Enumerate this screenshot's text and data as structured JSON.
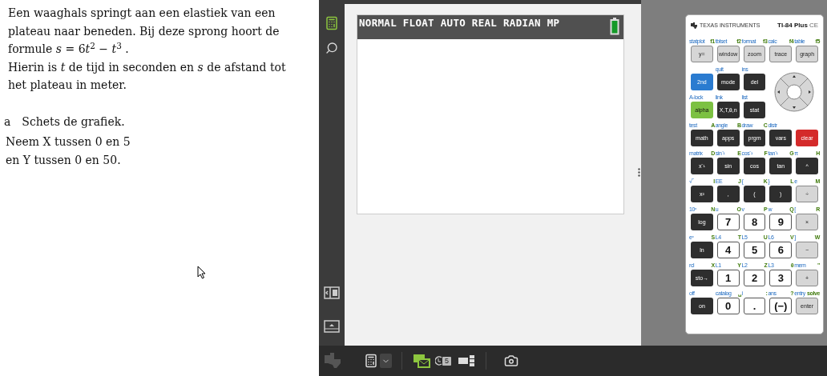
{
  "problem": {
    "lines": [
      "Een waaghals springt aan een elastiek van een",
      "plateau naar beneden. Bij deze sprong hoort de",
      "formule *s* = 6𝑡$^{2}$ − *t*$^{3}$ .",
      "Hierin is *t* de tijd in seconden en *s* de afstand tot",
      "het plateau in meter."
    ],
    "question": {
      "letter": "a",
      "text": "Schets de grafiek."
    },
    "hint": [
      "Neem X tussen 0 en 5",
      "en Y tussen 0 en 50."
    ]
  },
  "screen": {
    "status": "NORMAL FLOAT AUTO REAL RADIAN MP"
  },
  "calculator": {
    "brand": "TEXAS INSTRUMENTS",
    "model": "TI-84 Plus",
    "edition": "CE",
    "rows": [
      [
        {
          "label": "y=",
          "kind": "gray",
          "second": "statplot",
          "alpha": "f1"
        },
        {
          "label": "window",
          "kind": "gray",
          "second": "tblset",
          "alpha": "f2"
        },
        {
          "label": "zoom",
          "kind": "gray",
          "second": "format",
          "alpha": "f3"
        },
        {
          "label": "trace",
          "kind": "gray",
          "second": "calc",
          "alpha": "f4"
        },
        {
          "label": "graph",
          "kind": "gray",
          "second": "table",
          "alpha": "f5"
        }
      ],
      [
        {
          "label": "2nd",
          "kind": "blue"
        },
        {
          "label": "mode",
          "kind": "dark",
          "second": "quit"
        },
        {
          "label": "del",
          "kind": "dark",
          "second": "ins"
        }
      ],
      [
        {
          "label": "alpha",
          "kind": "green",
          "second": "A-lock"
        },
        {
          "label": "X,T,θ,n",
          "kind": "dark",
          "second": "link"
        },
        {
          "label": "stat",
          "kind": "dark",
          "second": "list"
        }
      ],
      [
        {
          "label": "math",
          "kind": "dark",
          "second": "test",
          "alpha": "A"
        },
        {
          "label": "apps",
          "kind": "dark",
          "second": "angle",
          "alpha": "B"
        },
        {
          "label": "prgm",
          "kind": "dark",
          "second": "draw",
          "alpha": "C"
        },
        {
          "label": "vars",
          "kind": "dark",
          "second": "distr"
        },
        {
          "label": "clear",
          "kind": "red"
        }
      ],
      [
        {
          "label": "x⁻¹",
          "kind": "dark",
          "second": "matrix",
          "alpha": "D"
        },
        {
          "label": "sin",
          "kind": "dark",
          "second": "sin⁻¹",
          "alpha": "E"
        },
        {
          "label": "cos",
          "kind": "dark",
          "second": "cos⁻¹",
          "alpha": "F"
        },
        {
          "label": "tan",
          "kind": "dark",
          "second": "tan⁻¹",
          "alpha": "G"
        },
        {
          "label": "^",
          "kind": "dark",
          "second": "π",
          "alpha": "H"
        }
      ],
      [
        {
          "label": "x²",
          "kind": "dark",
          "second": "√‾",
          "alpha": "I"
        },
        {
          "label": ",",
          "kind": "dark",
          "second": "EE",
          "alpha": "J"
        },
        {
          "label": "(",
          "kind": "dark",
          "second": "{",
          "alpha": "K"
        },
        {
          "label": ")",
          "kind": "dark",
          "second": "}",
          "alpha": "L"
        },
        {
          "label": "÷",
          "kind": "gray",
          "second": "e",
          "alpha": "M"
        }
      ],
      [
        {
          "label": "log",
          "kind": "dark",
          "second": "10ˣ",
          "alpha": "N"
        },
        {
          "label": "7",
          "kind": "white",
          "second": "u",
          "alpha": "O"
        },
        {
          "label": "8",
          "kind": "white",
          "second": "v",
          "alpha": "P"
        },
        {
          "label": "9",
          "kind": "white",
          "second": "w",
          "alpha": "Q"
        },
        {
          "label": "×",
          "kind": "gray",
          "second": "[",
          "alpha": "R"
        }
      ],
      [
        {
          "label": "ln",
          "kind": "dark",
          "second": "eˣ",
          "alpha": "S"
        },
        {
          "label": "4",
          "kind": "white",
          "second": "L4",
          "alpha": "T"
        },
        {
          "label": "5",
          "kind": "white",
          "second": "L5",
          "alpha": "U"
        },
        {
          "label": "6",
          "kind": "white",
          "second": "L6",
          "alpha": "V"
        },
        {
          "label": "−",
          "kind": "gray",
          "second": "]",
          "alpha": "W"
        }
      ],
      [
        {
          "label": "sto→",
          "kind": "dark",
          "second": "rcl",
          "alpha": "X"
        },
        {
          "label": "1",
          "kind": "white",
          "second": "L1",
          "alpha": "Y"
        },
        {
          "label": "2",
          "kind": "white",
          "second": "L2",
          "alpha": "Z"
        },
        {
          "label": "3",
          "kind": "white",
          "second": "L3",
          "alpha": "θ"
        },
        {
          "label": "+",
          "kind": "gray",
          "second": "mem",
          "alpha": "\""
        }
      ],
      [
        {
          "label": "on",
          "kind": "dark",
          "second": "off"
        },
        {
          "label": "0",
          "kind": "white",
          "second": "catalog",
          "alpha": "␣"
        },
        {
          "label": ".",
          "kind": "white",
          "second": "i",
          "alpha": ":"
        },
        {
          "label": "(−)",
          "kind": "white",
          "second": "ans",
          "alpha": "?"
        },
        {
          "label": "enter",
          "kind": "gray",
          "second": "entry",
          "alpha": "solve"
        }
      ]
    ]
  },
  "toolbar": {
    "history_count": "5"
  }
}
